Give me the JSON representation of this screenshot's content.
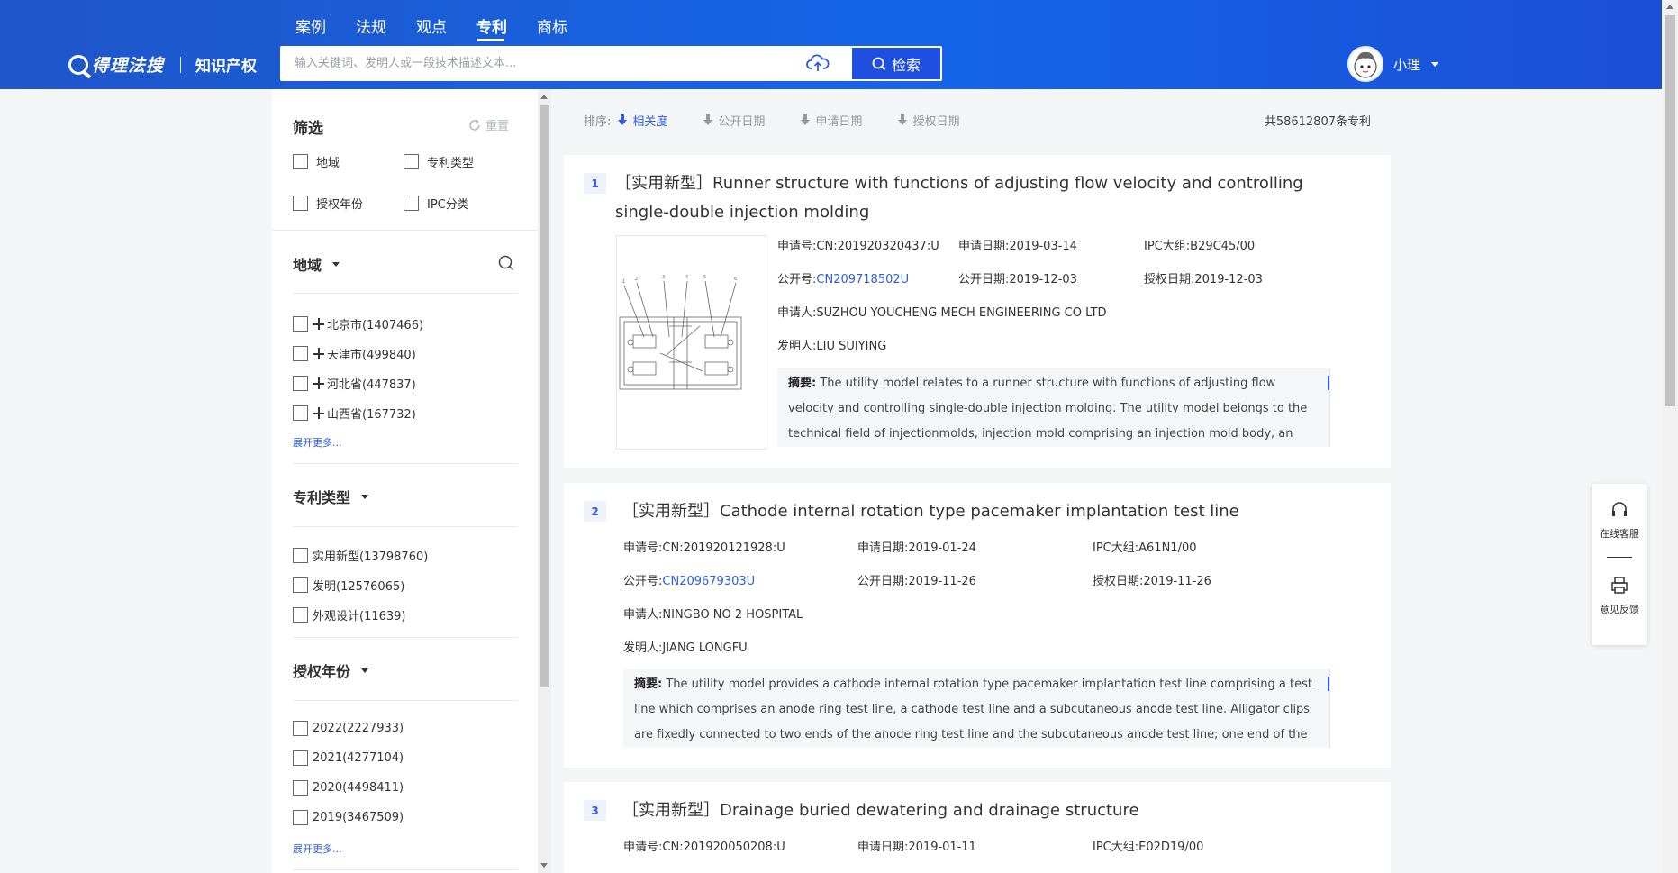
{
  "header": {
    "nav": [
      "案例",
      "法规",
      "观点",
      "专利",
      "商标"
    ],
    "active_nav": "专利",
    "logo_text": "得理法搜",
    "logo_sub": "知识产权",
    "search_placeholder": "输入关键词、发明人或一段技术描述文本...",
    "search_button": "检索",
    "user_name": "小理"
  },
  "sidebar": {
    "title": "筛选",
    "reset": "重置",
    "filters": [
      "地域",
      "专利类型",
      "授权年份",
      "IPC分类"
    ],
    "groups": {
      "region": {
        "title": "地域",
        "items": [
          "北京市(1407466)",
          "天津市(499840)",
          "河北省(447837)",
          "山西省(167732)"
        ],
        "more": "展开更多..."
      },
      "patent_type": {
        "title": "专利类型",
        "items": [
          "实用新型(13798760)",
          "发明(12576065)",
          "外观设计(11639)"
        ]
      },
      "grant_year": {
        "title": "授权年份",
        "items": [
          "2022(2227933)",
          "2021(4277104)",
          "2020(4498411)",
          "2019(3467509)"
        ],
        "more": "展开更多..."
      }
    }
  },
  "sort": {
    "label": "排序:",
    "options": [
      "相关度",
      "公开日期",
      "申请日期",
      "授权日期"
    ],
    "active": "相关度",
    "total": "共58612807条专利"
  },
  "results": [
    {
      "index": "1",
      "title": "［实用新型］Runner structure with functions of adjusting flow velocity and controlling single-double injection molding",
      "app_no_label": "申请号:",
      "app_no": "CN:201920320437:U",
      "app_date_label": "申请日期:",
      "app_date": "2019-03-14",
      "ipc_label": "IPC大组:",
      "ipc": "B29C45/00",
      "pub_no_label": "公开号:",
      "pub_no": "CN209718502U",
      "pub_date_label": "公开日期:",
      "pub_date": "2019-12-03",
      "grant_date_label": "授权日期:",
      "grant_date": "2019-12-03",
      "applicant_label": "申请人:",
      "applicant": "SUZHOU YOUCHENG MECH ENGINEERING CO LTD",
      "inventor_label": "发明人:",
      "inventor": "LIU SUIYING",
      "abstract_label": "摘要:",
      "abstract": "The utility model relates to a runner structure with functions of adjusting flow velocity and controlling single-double injection molding. The utility model belongs to the technical field of injectionmolds, injection mold comprising an injection mold body, an injection molding part"
    },
    {
      "index": "2",
      "title": "［实用新型］Cathode internal rotation type pacemaker implantation test line",
      "app_no_label": "申请号:",
      "app_no": "CN:201920121928:U",
      "app_date_label": "申请日期:",
      "app_date": "2019-01-24",
      "ipc_label": "IPC大组:",
      "ipc": "A61N1/00",
      "pub_no_label": "公开号:",
      "pub_no": "CN209679303U",
      "pub_date_label": "公开日期:",
      "pub_date": "2019-11-26",
      "grant_date_label": "授权日期:",
      "grant_date": "2019-11-26",
      "applicant_label": "申请人:",
      "applicant": "NINGBO NO 2 HOSPITAL",
      "inventor_label": "发明人:",
      "inventor": "JIANG LONGFU",
      "abstract_label": "摘要:",
      "abstract": "The utility model provides a cathode internal rotation type pacemaker implantation test line comprising a test line which comprises an anode ring test line, a cathode test line and a subcutaneous anode test line. Alligator clips are fixedly connected to two ends of the anode ring test line and the subcutaneous anode test line; one end of the cathode test line i"
    },
    {
      "index": "3",
      "title": "［实用新型］Drainage buried dewatering and drainage structure",
      "app_no_label": "申请号:",
      "app_no": "CN:201920050208:U",
      "app_date_label": "申请日期:",
      "app_date": "2019-01-11",
      "ipc_label": "IPC大组:",
      "ipc": "E02D19/00"
    }
  ],
  "float": {
    "service": "在线客服",
    "feedback": "意见反馈"
  },
  "colors": {
    "header": "#1565e8",
    "accent": "#2f5ce0",
    "search_button": "#1e4fe0"
  }
}
